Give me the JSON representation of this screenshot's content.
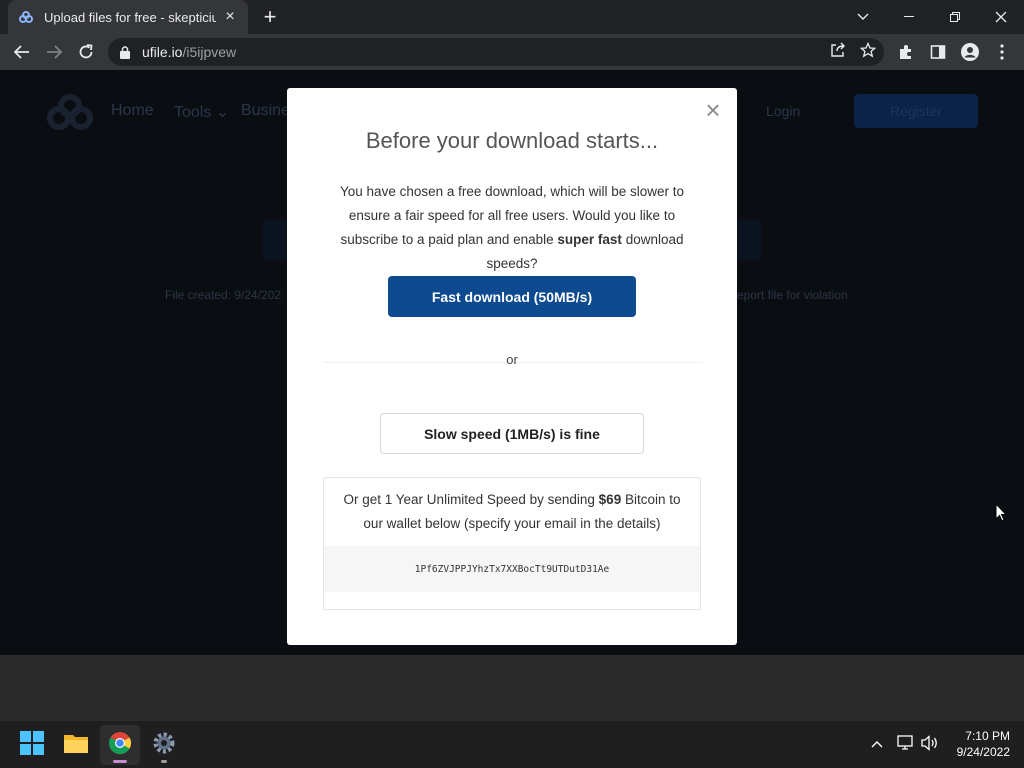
{
  "browser": {
    "tab_title": "Upload files for free - skepticium",
    "url_domain": "ufile.io",
    "url_path": "/i5ijpvew"
  },
  "site": {
    "nav": [
      "Home",
      "Tools ⌄",
      "Busine"
    ],
    "login": "Login",
    "register": "Register",
    "file_created": "File created: 9/24/202",
    "report": "eport file for violation"
  },
  "modal": {
    "title": "Before your download starts...",
    "text_part1": "You have chosen a free download, which will be slower to ensure a fair speed for all free users. Would you like to subscribe to a paid plan and enable ",
    "text_bold": "super fast",
    "text_part2": " download speeds?",
    "fast_button": "Fast download (50MB/s)",
    "or": "or",
    "slow_button": "Slow speed (1MB/s) is fine",
    "btc_part1": "Or get 1 Year Unlimited Speed by sending ",
    "btc_amount": "$69",
    "btc_part2": " Bitcoin to our wallet below (specify your email in the details)",
    "wallet": "1Pf6ZVJPPJYhzTx7XXBocTt9UTDutD31Ae",
    "close": "×"
  },
  "taskbar": {
    "time": "7:10 PM",
    "date": "9/24/2022"
  },
  "colors": {
    "accent": "#0d4a8f",
    "page_bg": "#0a0d12"
  }
}
